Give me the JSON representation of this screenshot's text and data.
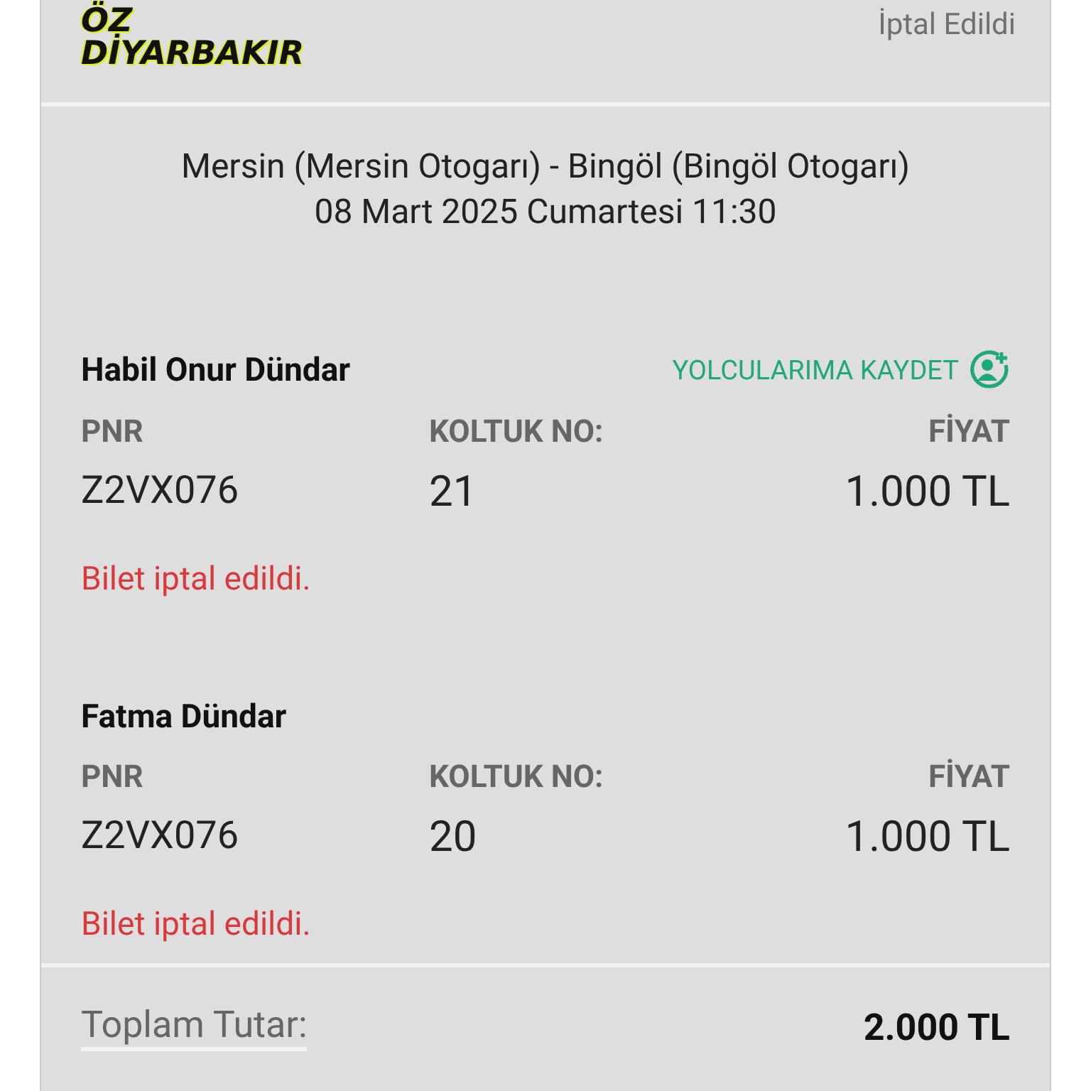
{
  "header": {
    "logo_lines": [
      "ÖZ",
      "DİYARBAKIR"
    ],
    "status": "İptal Edildi"
  },
  "route": {
    "line": "Mersin (Mersin Otogarı) - Bingöl (Bingöl Otogarı)",
    "datetime": "08 Mart 2025 Cumartesi 11:30"
  },
  "save_action": {
    "label": "YOLCULARIMA KAYDET"
  },
  "passengers": [
    {
      "name": "Habil Onur Dündar",
      "show_save": true,
      "pnr_label": "PNR",
      "pnr": "Z2VX076",
      "seat_label": "KOLTUK NO:",
      "seat": "21",
      "price_label": "FİYAT",
      "price": "1.000 TL",
      "status": "Bilet iptal edildi."
    },
    {
      "name": "Fatma Dündar",
      "show_save": false,
      "pnr_label": "PNR",
      "pnr": "Z2VX076",
      "seat_label": "KOLTUK NO:",
      "seat": "20",
      "price_label": "FİYAT",
      "price": "1.000 TL",
      "status": "Bilet iptal edildi."
    }
  ],
  "total": {
    "label": "Toplam Tutar:",
    "value": "2.000 TL"
  }
}
